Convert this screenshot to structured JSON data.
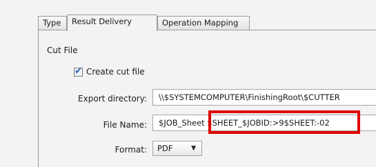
{
  "tabs": [
    {
      "label": "Type",
      "active": false
    },
    {
      "label": "Result Delivery",
      "active": true
    },
    {
      "label": "Operation Mapping",
      "active": false
    }
  ],
  "cut_file": {
    "section_label": "Cut File",
    "create_checkbox_label": "Create cut file",
    "create_checked": true,
    "export_label": "Export directory:",
    "export_value": "\\\\$SYSTEMCOMPUTER\\FinishingRoot\\$CUTTER",
    "name_label": "File Name:",
    "name_value": "$JOB_Sheet $SHEET_$JOBID:>9$SHEET:-02",
    "format_label": "Format:",
    "format_value": "PDF"
  },
  "highlight_color": "#e00000",
  "icons": {
    "checkbox": "checkmark-icon",
    "dropdown": "chevron-down-icon"
  }
}
